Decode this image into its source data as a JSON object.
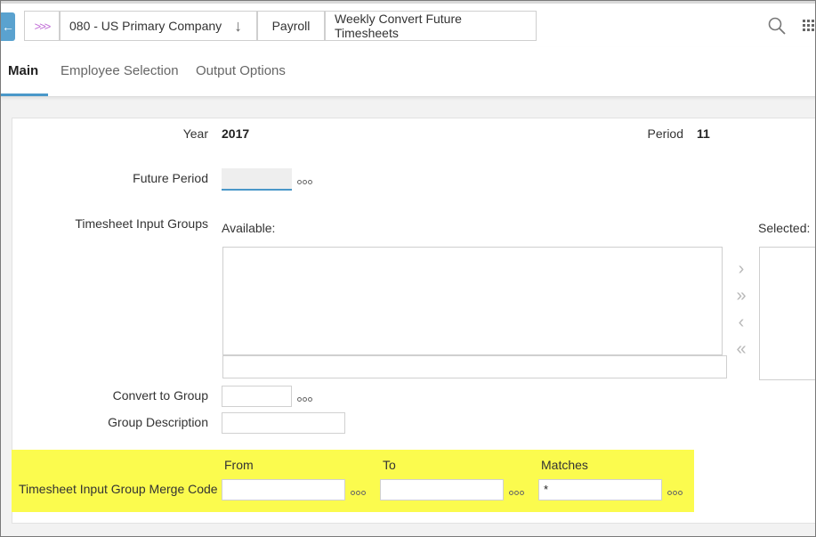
{
  "header": {
    "back_icon": "arrow-left-icon",
    "home_icon": "triple-chevron-icon",
    "breadcrumbs": {
      "company": "080 - US Primary Company",
      "module": "Payroll",
      "task": "Weekly Convert Future Timesheets"
    },
    "company_arrow": "↓"
  },
  "tabs": {
    "main": "Main",
    "employee_selection": "Employee Selection",
    "output_options": "Output Options"
  },
  "form": {
    "year_label": "Year",
    "year_value": "2017",
    "period_label": "Period",
    "period_value": "11",
    "future_period_label": "Future Period",
    "future_period_value": "",
    "input_groups_label": "Timesheet Input Groups",
    "available_label": "Available:",
    "selected_label": "Selected:",
    "available_filter_value": "",
    "convert_to_group_label": "Convert to Group",
    "convert_to_group_value": "",
    "group_description_label": "Group Description",
    "group_description_value": ""
  },
  "merge": {
    "from_label": "From",
    "to_label": "To",
    "matches_label": "Matches",
    "row_label": "Timesheet Input Group Merge Code",
    "from_value": "",
    "to_value": "",
    "matches_value": "*"
  },
  "colors": {
    "accent": "#4a98c9",
    "highlight": "#fbfb4e",
    "back_button": "#5aa2cf"
  }
}
